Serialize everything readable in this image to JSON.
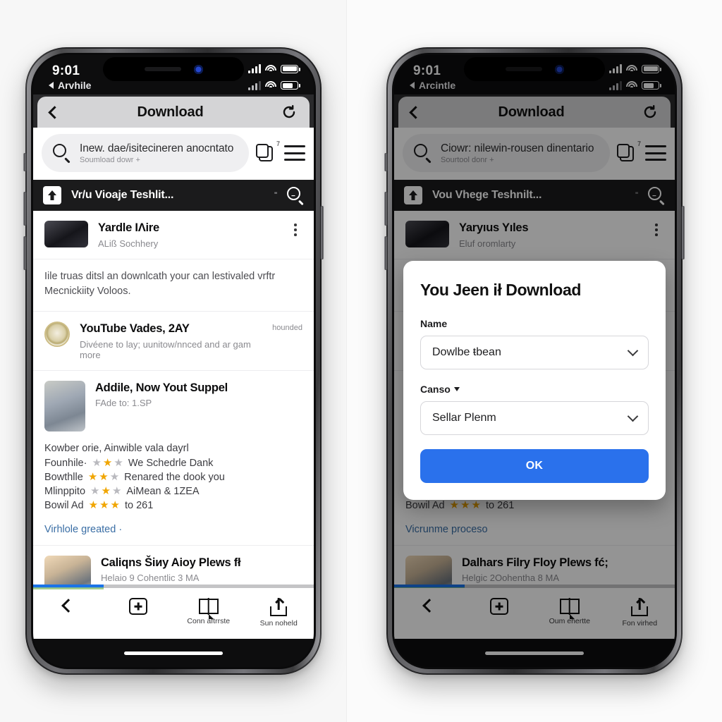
{
  "status_bar": {
    "time": "9:01",
    "back_label": "Arvhile",
    "back_label_right": "Arcintle",
    "icons": [
      "signal-bars-icon",
      "wifi-icon",
      "battery-icon"
    ]
  },
  "browser": {
    "nav": {
      "back_icon": "chevron-left-icon",
      "title": "Download",
      "reload_icon": "reload-icon"
    },
    "url_bar": {
      "search_icon": "search-icon",
      "value": "Inew. dae/isitecineren anocntato",
      "value_right": "Ciowr: nilewin-rousen dinentario",
      "subtitle": "Soumload dowr +",
      "subtitle_right": "Sourtool donr +",
      "tabs_icon": "tabs-icon",
      "tabs_badge": "7",
      "menu_icon": "hamburger-menu-icon"
    }
  },
  "app_header": {
    "home_icon": "home-upload-icon",
    "title": "Vr/u Vioaje Teshlit...",
    "title_right": "Vou Vhege Teshnilt...",
    "superscript": "\"",
    "zoom_icon": "zoom-search-icon"
  },
  "content": {
    "channel_row": {
      "title": "Yardle IΛire",
      "title_right": "Yaryıus Yıles",
      "subtitle": "ALiß Sochhery",
      "subtitle_right": "Eluf oromlarty",
      "menu_icon": "kebab-menu-icon",
      "avatar": "channel-avatar"
    },
    "description": "Iile truas ditsl an downlcath your can lestivaled vrftr Mecnickiity Voloos.",
    "video_row": {
      "title": "YouTube Vades, 2AY",
      "subtitle": "Divéene to lay; uunitow/nnced and ar gam more",
      "flag": "hounded",
      "avatar": "video-avatar"
    },
    "article_row": {
      "title": "Addile, Now Yout Suppel",
      "subtitle": "FAde to: 1.SP",
      "avatar": "article-thumbnail"
    },
    "ratings": {
      "heading": "Kowber orie, Ainwible vala dayrl",
      "rows": [
        {
          "label": "Founhile·",
          "stars": 2,
          "filled": [
            false,
            true,
            false
          ],
          "text": "We Schedrle Dank"
        },
        {
          "label": "Bowthlle",
          "stars": 3,
          "filled": [
            true,
            true,
            false
          ],
          "text": "Renared the dook you"
        },
        {
          "label": "Mlinppito",
          "stars": 3,
          "filled": [
            false,
            true,
            false
          ],
          "text": "AiMean & 1ZEA"
        },
        {
          "label": "Bowil Ad",
          "stars": 3,
          "filled": [
            true,
            true,
            true
          ],
          "text": "to 261"
        }
      ]
    },
    "more_link": "Virhlole greated ·",
    "more_link_right": "Vicrunme proceso",
    "last_row": {
      "title": "Caliqns Šіиy Aioy Plews fł",
      "title_right": "Dalhars Filry Floy Plews fć;",
      "subtitle": "Helaio 9 Cohentlic 3 MA",
      "subtitle_right": "Helgic 2Oohentha 8 MA",
      "avatar": "last-thumbnail"
    }
  },
  "progress": {
    "percent": 25,
    "fill_color": "#1a73e8",
    "track_color": "#c4c4c6"
  },
  "bottom_nav": [
    {
      "name": "back",
      "icon": "chevron-left-icon",
      "label": ""
    },
    {
      "name": "add",
      "icon": "add-box-icon",
      "label": ""
    },
    {
      "name": "comments",
      "icon": "book-comment-icon",
      "label": "Conn aftrrste",
      "label_right": "Oum ehertte"
    },
    {
      "name": "share",
      "icon": "share-upload-icon",
      "label": "Sun noheld",
      "label_right": "Fon virhed"
    }
  ],
  "modal": {
    "title": "You Jeen ił Download",
    "name_label": "Name",
    "name_value": "Dowlbe ŧbean",
    "second_label": "Canso",
    "second_value": "Sellar Plenm",
    "ok_label": "OK",
    "ok_color": "#2a71ec",
    "dropdown_icon": "chevron-down-icon"
  }
}
